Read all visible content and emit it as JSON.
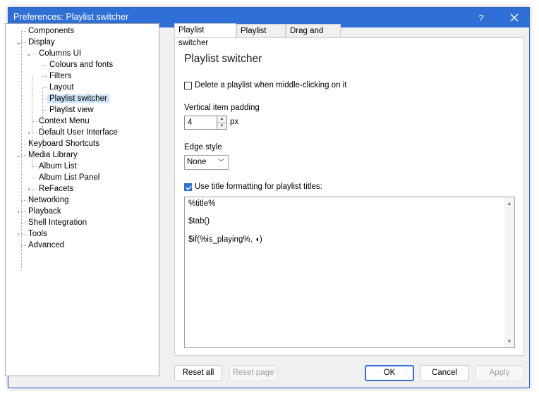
{
  "window": {
    "title": "Preferences: Playlist switcher"
  },
  "titlebar": {
    "help": "?"
  },
  "tree": [
    {
      "label": "Components",
      "depth": 0,
      "expander": ""
    },
    {
      "label": "Display",
      "depth": 0,
      "expander": "collapse"
    },
    {
      "label": "Columns UI",
      "depth": 1,
      "expander": "collapse"
    },
    {
      "label": "Colours and fonts",
      "depth": 2,
      "expander": ""
    },
    {
      "label": "Filters",
      "depth": 2,
      "expander": ""
    },
    {
      "label": "Layout",
      "depth": 2,
      "expander": ""
    },
    {
      "label": "Playlist switcher",
      "depth": 2,
      "expander": "",
      "selected": true
    },
    {
      "label": "Playlist view",
      "depth": 2,
      "expander": ""
    },
    {
      "label": "Context Menu",
      "depth": 1,
      "expander": ""
    },
    {
      "label": "Default User Interface",
      "depth": 1,
      "expander": "expand"
    },
    {
      "label": "Keyboard Shortcuts",
      "depth": 0,
      "expander": ""
    },
    {
      "label": "Media Library",
      "depth": 0,
      "expander": "collapse"
    },
    {
      "label": "Album List",
      "depth": 1,
      "expander": ""
    },
    {
      "label": "Album List Panel",
      "depth": 1,
      "expander": ""
    },
    {
      "label": "ReFacets",
      "depth": 1,
      "expander": "expand"
    },
    {
      "label": "Networking",
      "depth": 0,
      "expander": ""
    },
    {
      "label": "Playback",
      "depth": 0,
      "expander": "expand"
    },
    {
      "label": "Shell Integration",
      "depth": 0,
      "expander": ""
    },
    {
      "label": "Tools",
      "depth": 0,
      "expander": "expand"
    },
    {
      "label": "Advanced",
      "depth": 0,
      "expander": ""
    }
  ],
  "tabs": [
    {
      "label": "Playlist switcher",
      "active": true
    },
    {
      "label": "Playlist tabs",
      "active": false
    },
    {
      "label": "Drag and drop",
      "active": false
    }
  ],
  "panel": {
    "title": "Playlist switcher",
    "delete_middle_click": {
      "label": "Delete a playlist when middle-clicking on it",
      "checked": false
    },
    "padding_label": "Vertical item padding",
    "padding_value": "4",
    "padding_unit": "px",
    "edge_label": "Edge style",
    "edge_value": "None",
    "title_formatting": {
      "label": "Use title formatting for playlist titles:",
      "checked": true
    },
    "script_lines": [
      "%title%",
      "$tab()",
      "$if(%is_playing%, ◖)"
    ]
  },
  "buttons": {
    "reset_all": "Reset all",
    "reset_page": "Reset page",
    "ok": "OK",
    "cancel": "Cancel",
    "apply": "Apply"
  },
  "colors": {
    "accent": "#2f6fd6",
    "selection": "#cce4f7"
  }
}
